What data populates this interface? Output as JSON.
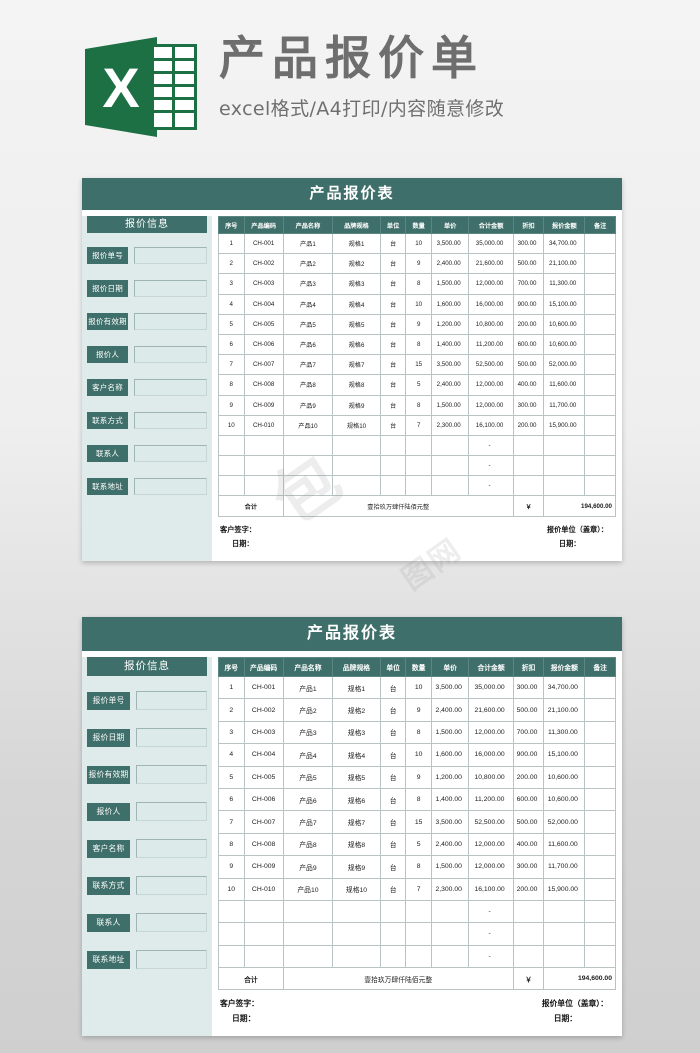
{
  "banner": {
    "logo_letter": "X",
    "logo_name": "excel-logo",
    "title": "产品报价单",
    "subtitle": "excel格式/A4打印/内容随意修改"
  },
  "sheet": {
    "title": "产品报价表",
    "sidebar": {
      "heading": "报价信息",
      "fields": [
        {
          "label": "报价单号",
          "value": ""
        },
        {
          "label": "报价日期",
          "value": ""
        },
        {
          "label": "报价有效期",
          "value": ""
        },
        {
          "label": "报价人",
          "value": ""
        },
        {
          "label": "客户名称",
          "value": ""
        },
        {
          "label": "联系方式",
          "value": ""
        },
        {
          "label": "联系人",
          "value": ""
        },
        {
          "label": "联系地址",
          "value": ""
        }
      ]
    },
    "table": {
      "columns": [
        "序号",
        "产品编码",
        "产品名称",
        "品牌规格",
        "单位",
        "数量",
        "单价",
        "合计金额",
        "折扣",
        "报价金额",
        "备注"
      ],
      "rows": [
        [
          "1",
          "CH-001",
          "产品1",
          "规格1",
          "台",
          "10",
          "3,500.00",
          "35,000.00",
          "300.00",
          "34,700.00",
          ""
        ],
        [
          "2",
          "CH-002",
          "产品2",
          "规格2",
          "台",
          "9",
          "2,400.00",
          "21,600.00",
          "500.00",
          "21,100.00",
          ""
        ],
        [
          "3",
          "CH-003",
          "产品3",
          "规格3",
          "台",
          "8",
          "1,500.00",
          "12,000.00",
          "700.00",
          "11,300.00",
          ""
        ],
        [
          "4",
          "CH-004",
          "产品4",
          "规格4",
          "台",
          "10",
          "1,600.00",
          "16,000.00",
          "900.00",
          "15,100.00",
          ""
        ],
        [
          "5",
          "CH-005",
          "产品5",
          "规格5",
          "台",
          "9",
          "1,200.00",
          "10,800.00",
          "200.00",
          "10,600.00",
          ""
        ],
        [
          "6",
          "CH-006",
          "产品6",
          "规格6",
          "台",
          "8",
          "1,400.00",
          "11,200.00",
          "600.00",
          "10,600.00",
          ""
        ],
        [
          "7",
          "CH-007",
          "产品7",
          "规格7",
          "台",
          "15",
          "3,500.00",
          "52,500.00",
          "500.00",
          "52,000.00",
          ""
        ],
        [
          "8",
          "CH-008",
          "产品8",
          "规格8",
          "台",
          "5",
          "2,400.00",
          "12,000.00",
          "400.00",
          "11,600.00",
          ""
        ],
        [
          "9",
          "CH-009",
          "产品9",
          "规格9",
          "台",
          "8",
          "1,500.00",
          "12,000.00",
          "300.00",
          "11,700.00",
          ""
        ],
        [
          "10",
          "CH-010",
          "产品10",
          "规格10",
          "台",
          "7",
          "2,300.00",
          "16,100.00",
          "200.00",
          "15,900.00",
          ""
        ]
      ],
      "empty_rows": [
        [
          "",
          "",
          "",
          "",
          "",
          "",
          "",
          "-",
          "",
          "",
          ""
        ],
        [
          "",
          "",
          "",
          "",
          "",
          "",
          "",
          "-",
          "",
          "",
          ""
        ],
        [
          "",
          "",
          "",
          "",
          "",
          "",
          "",
          "-",
          "",
          "",
          ""
        ]
      ],
      "total": {
        "label": "合计",
        "words": "壹拾玖万肆仟陆佰元整",
        "currency": "￥",
        "amount": "194,600.00"
      }
    },
    "signature": {
      "customer_sign": "客户签字：",
      "customer_date": "日期：",
      "vendor_sign": "报价单位（盖章）：",
      "vendor_date": "日期："
    }
  },
  "watermark": {
    "mark": "包",
    "text": "图网"
  },
  "colors": {
    "teal": "#3f6f6a",
    "sidebar_bg": "#dfeaea",
    "excel_green": "#1d7044",
    "title_gray": "#6e6e6e"
  }
}
